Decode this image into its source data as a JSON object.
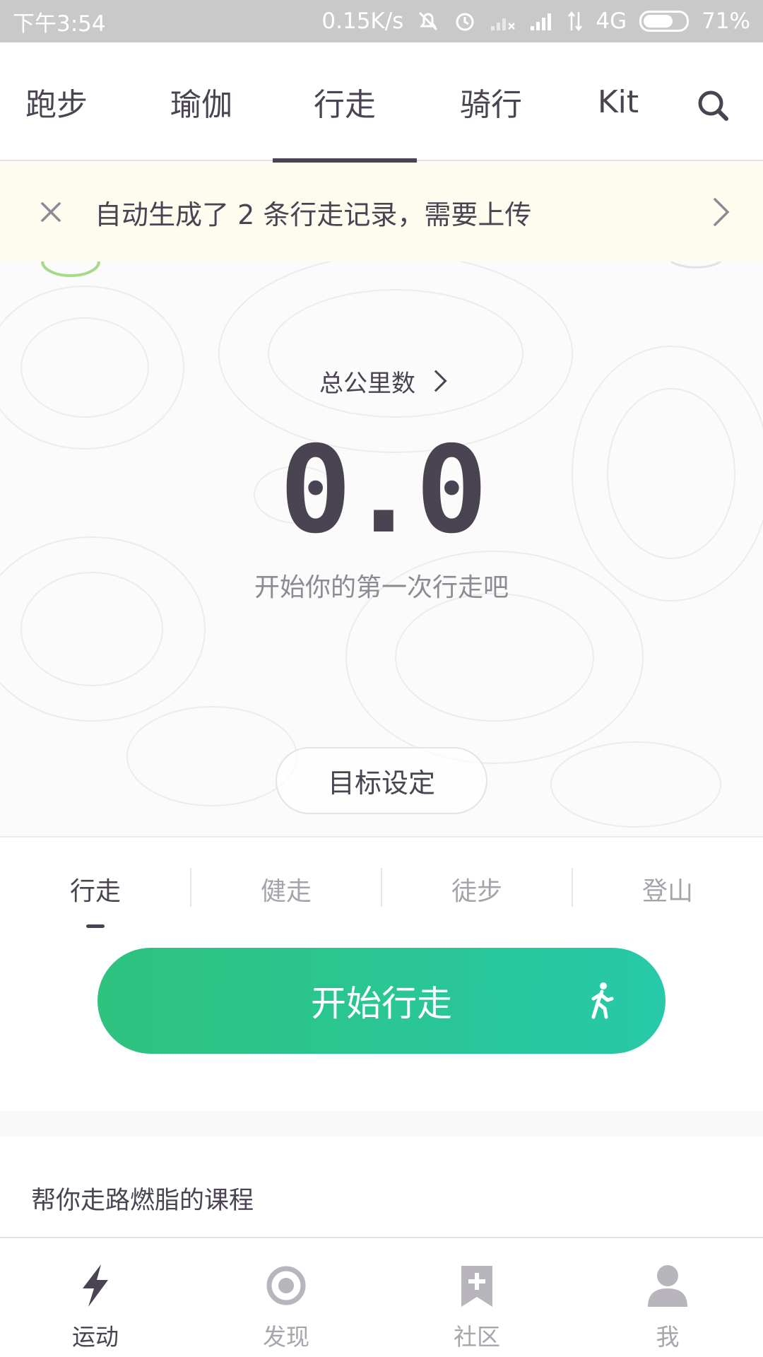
{
  "status_bar": {
    "time": "下午3:54",
    "net_speed": "0.15K/s",
    "network": "4G",
    "battery": "71%",
    "battery_level": 0.71
  },
  "top_tabs": [
    {
      "label": "跑步"
    },
    {
      "label": "瑜伽"
    },
    {
      "label": "行走",
      "active": true
    },
    {
      "label": "骑行"
    },
    {
      "label": "Kit"
    }
  ],
  "search": {
    "icon": "search-icon"
  },
  "notice": {
    "text": "自动生成了 2 条行走记录，需要上传"
  },
  "hero": {
    "total_label": "总公里数",
    "total_value": "0.0",
    "subtitle": "开始你的第一次行走吧",
    "goal_button": "目标设定"
  },
  "sub_tabs": [
    {
      "label": "行走",
      "active": true
    },
    {
      "label": "健走"
    },
    {
      "label": "徒步"
    },
    {
      "label": "登山"
    }
  ],
  "start_button": {
    "label": "开始行走",
    "icon": "walking-person-icon"
  },
  "section": {
    "title": "帮你走路燃脂的课程"
  },
  "bottom_nav": [
    {
      "label": "运动",
      "icon": "lightning-icon",
      "active": true
    },
    {
      "label": "发现",
      "icon": "discover-circle-icon"
    },
    {
      "label": "社区",
      "icon": "bookmark-plus-icon"
    },
    {
      "label": "我",
      "icon": "person-icon"
    }
  ],
  "colors": {
    "primary_text": "#4a4452",
    "muted_text": "#a6a3aa",
    "gradient_start": "#2ec27e",
    "gradient_end": "#27c9a9",
    "notice_bg": "#fdfcef"
  }
}
